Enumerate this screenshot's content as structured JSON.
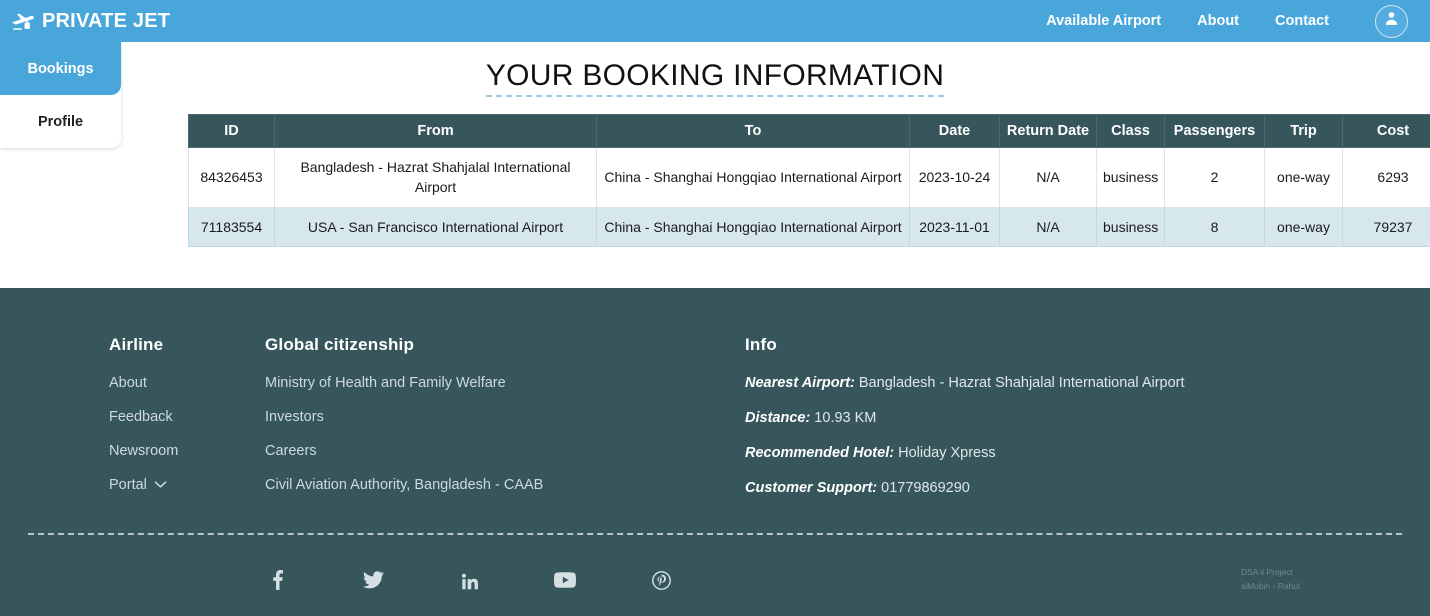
{
  "navbar": {
    "brand": "PRIVATE JET",
    "brand_icon": "private-jet-plane-icon",
    "links": [
      {
        "label": "Available Airport"
      },
      {
        "label": "About"
      },
      {
        "label": "Contact"
      }
    ],
    "avatar_icon": "user-avatar-icon",
    "background_color": "#48a6da"
  },
  "sidebar": {
    "items": [
      {
        "label": "Bookings",
        "active": true
      },
      {
        "label": "Profile",
        "active": false
      }
    ]
  },
  "main": {
    "title": "YOUR BOOKING INFORMATION",
    "table": {
      "columns": [
        "ID",
        "From",
        "To",
        "Date",
        "Return Date",
        "Class",
        "Passengers",
        "Trip",
        "Cost"
      ],
      "rows": [
        {
          "id": "84326453",
          "from": "Bangladesh - Hazrat Shahjalal International Airport",
          "to": "China - Shanghai Hongqiao International Airport",
          "date": "2023-10-24",
          "return_date": "N/A",
          "class": "business",
          "passengers": "2",
          "trip": "one-way",
          "cost": "6293"
        },
        {
          "id": "71183554",
          "from": "USA - San Francisco International Airport",
          "to": "China - Shanghai Hongqiao International Airport",
          "date": "2023-11-01",
          "return_date": "N/A",
          "class": "business",
          "passengers": "8",
          "trip": "one-way",
          "cost": "79237"
        }
      ]
    },
    "header_color": "#36565c",
    "row_alt_color": "#d6e7ee"
  },
  "footer": {
    "background_color": "#36565c",
    "columns": [
      {
        "heading": "Airline",
        "links": [
          {
            "label": "About",
            "caret": false
          },
          {
            "label": "Feedback",
            "caret": false
          },
          {
            "label": "Newsroom",
            "caret": false
          },
          {
            "label": "Portal",
            "caret": true
          }
        ]
      },
      {
        "heading": "Global citizenship",
        "links": [
          {
            "label": "Ministry of Health and Family Welfare",
            "caret": false
          },
          {
            "label": "Investors",
            "caret": false
          },
          {
            "label": "Careers",
            "caret": false
          },
          {
            "label": "Civil Aviation Authority, Bangladesh - CAAB",
            "caret": false
          }
        ]
      }
    ],
    "info": {
      "heading": "Info",
      "items": [
        {
          "label": "Nearest Airport:",
          "value": " Bangladesh - Hazrat Shahjalal International Airport"
        },
        {
          "label": "Distance:",
          "value": " 10.93 KM"
        },
        {
          "label": "Recommended Hotel:",
          "value": " Holiday Xpress"
        },
        {
          "label": "Customer Support:",
          "value": " 01779869290"
        }
      ]
    },
    "socials": [
      {
        "name": "facebook-icon"
      },
      {
        "name": "twitter-icon"
      },
      {
        "name": "linkedin-icon"
      },
      {
        "name": "youtube-icon"
      },
      {
        "name": "pinterest-icon"
      }
    ],
    "credits_line1": "DSA ii Project",
    "credits_line2": "siMobin  -  Rahul"
  }
}
